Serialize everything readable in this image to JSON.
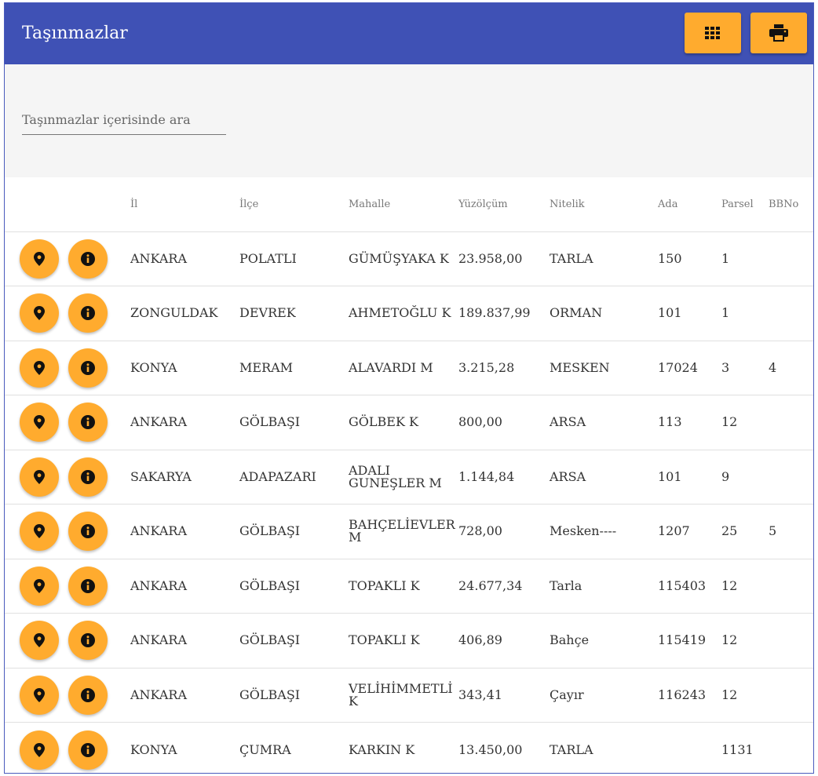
{
  "header": {
    "title": "Taşınmazlar",
    "grid_button_icon": "grid-icon",
    "print_button_icon": "print-icon",
    "colors": {
      "header_bg": "#3f51b5",
      "accent": "#ffab2e"
    }
  },
  "search": {
    "placeholder": "Taşınmazlar içerisinde ara",
    "value": ""
  },
  "table": {
    "columns": [
      "İl",
      "İlçe",
      "Mahalle",
      "Yüzölçüm",
      "Nitelik",
      "Ada",
      "Parsel",
      "BBNo"
    ],
    "row_actions": [
      "map-pin-icon",
      "info-icon"
    ],
    "rows": [
      {
        "il": "ANKARA",
        "ilce": "POLATLI",
        "mahalle": "GÜMÜŞYAKA K",
        "yuzolcum": "23.958,00",
        "nitelik": "TARLA",
        "ada": "150",
        "parsel": "1",
        "bbno": ""
      },
      {
        "il": "ZONGULDAK",
        "ilce": "DEVREK",
        "mahalle": "AHMETOĞLU K",
        "yuzolcum": "189.837,99",
        "nitelik": "ORMAN",
        "ada": "101",
        "parsel": "1",
        "bbno": ""
      },
      {
        "il": "KONYA",
        "ilce": "MERAM",
        "mahalle": "ALAVARDI M",
        "yuzolcum": "3.215,28",
        "nitelik": "MESKEN",
        "ada": "17024",
        "parsel": "3",
        "bbno": "4"
      },
      {
        "il": "ANKARA",
        "ilce": "GÖLBAŞI",
        "mahalle": "GÖLBEK K",
        "yuzolcum": "800,00",
        "nitelik": "ARSA",
        "ada": "113",
        "parsel": "12",
        "bbno": ""
      },
      {
        "il": "SAKARYA",
        "ilce": "ADAPAZARI",
        "mahalle": "ADALI GUNEŞLER M",
        "yuzolcum": "1.144,84",
        "nitelik": "ARSA",
        "ada": "101",
        "parsel": "9",
        "bbno": ""
      },
      {
        "il": "ANKARA",
        "ilce": "GÖLBAŞI",
        "mahalle": "BAHÇELİEVLER M",
        "yuzolcum": "728,00",
        "nitelik": "Mesken----",
        "ada": "1207",
        "parsel": "25",
        "bbno": "5"
      },
      {
        "il": "ANKARA",
        "ilce": "GÖLBAŞI",
        "mahalle": "TOPAKLI K",
        "yuzolcum": "24.677,34",
        "nitelik": "Tarla",
        "ada": "115403",
        "parsel": "12",
        "bbno": ""
      },
      {
        "il": "ANKARA",
        "ilce": "GÖLBAŞI",
        "mahalle": "TOPAKLI K",
        "yuzolcum": "406,89",
        "nitelik": "Bahçe",
        "ada": "115419",
        "parsel": "12",
        "bbno": ""
      },
      {
        "il": "ANKARA",
        "ilce": "GÖLBAŞI",
        "mahalle": "VELİHİMMETLİ K",
        "yuzolcum": "343,41",
        "nitelik": "Çayır",
        "ada": "116243",
        "parsel": "12",
        "bbno": ""
      },
      {
        "il": "KONYA",
        "ilce": "ÇUMRA",
        "mahalle": "KARKIN K",
        "yuzolcum": "13.450,00",
        "nitelik": "TARLA",
        "ada": "",
        "parsel": "1131",
        "bbno": ""
      }
    ]
  }
}
